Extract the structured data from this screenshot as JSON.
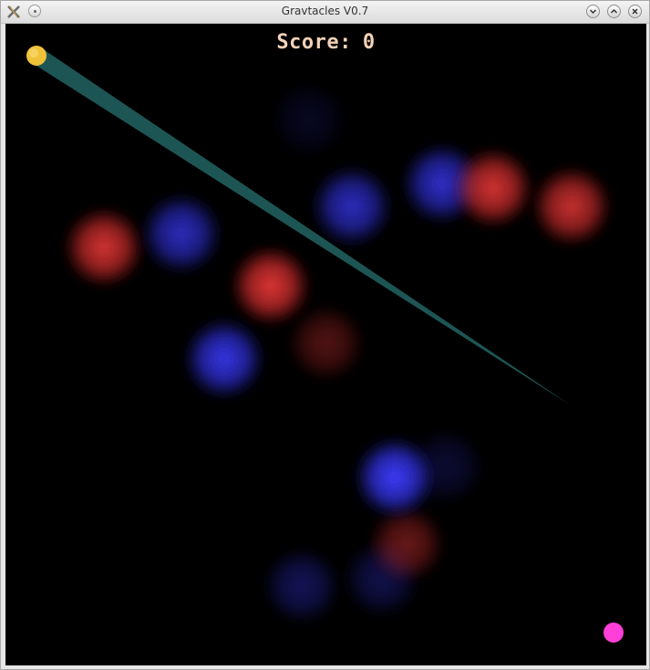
{
  "window": {
    "title": "Gravtacles V0.7"
  },
  "hud": {
    "score_label": "Score:",
    "score_value": "0"
  },
  "icons": {
    "app": "app-x-icon",
    "menu": "window-menu-icon",
    "minimize": "chevron-down-icon",
    "maximize": "chevron-up-icon",
    "close": "close-icon"
  },
  "game": {
    "player_color": "#f0c23a",
    "target_color": "#ff3fd8",
    "trail_color": "#1f5a58",
    "repulsor_color": "#e03030",
    "attractor_color": "#3535f0"
  }
}
